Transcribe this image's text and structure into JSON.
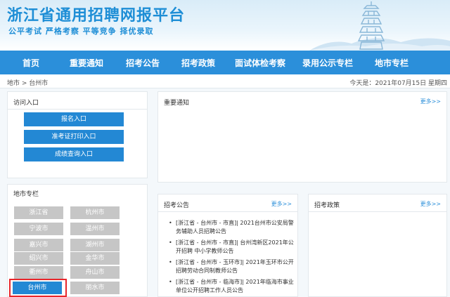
{
  "header": {
    "title": "浙江省通用招聘网报平台",
    "slogan": "公平考试 严格考察 平等竞争 择优录取"
  },
  "nav": {
    "items": [
      "首页",
      "重要通知",
      "招考公告",
      "招考政策",
      "面试体检考察",
      "录用公示专栏",
      "地市专栏"
    ]
  },
  "breadcrumb": "地市 > 台州市",
  "date": "今天是：2021年07月15日 星期四",
  "access_panel": {
    "title": "访问入口",
    "buttons": [
      "报名入口",
      "准考证打印入口",
      "成绩查询入口"
    ]
  },
  "notice_panel": {
    "title": "重要通知",
    "more": "更多>>"
  },
  "city_panel": {
    "title": "地市专栏",
    "cities": [
      "浙江省",
      "杭州市",
      "宁波市",
      "温州市",
      "嘉兴市",
      "湖州市",
      "绍兴市",
      "金华市",
      "衢州市",
      "舟山市",
      "台州市",
      "丽水市"
    ],
    "active": "台州市"
  },
  "announce_panel": {
    "title": "招考公告",
    "more": "更多>>",
    "items": [
      "[浙江省 - 台州市 - 市直]| 2021台州市公安局警务辅助人员招聘公告",
      "[浙江省 - 台州市 - 市直]| 台州湾新区2021年公开招聘 中小学教师公告",
      "[浙江省 - 台州市 - 玉环市]| 2021年玉环市公开招聘劳动合同制教师公告",
      "[浙江省 - 台州市 - 临海市]| 2021年临海市事业单位公开招聘工作人员公告"
    ]
  },
  "policy_panel": {
    "title": "招考政策",
    "more": "更多>>"
  },
  "colors": {
    "brand": "#1e8ed6",
    "nav": "#2b8fda",
    "button": "#2388d4",
    "city_inactive": "#c6c6c6",
    "highlight": "#e8262b"
  }
}
